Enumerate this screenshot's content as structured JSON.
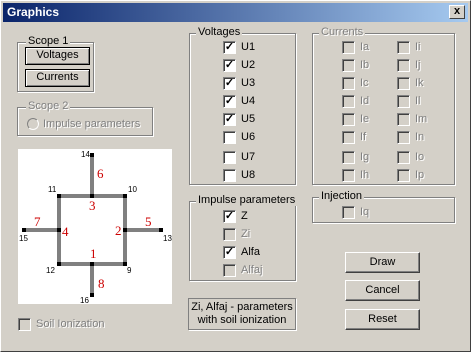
{
  "window": {
    "title": "Graphics",
    "close_glyph": "x"
  },
  "scope1": {
    "legend": "Scope 1",
    "voltages_button": "Voltages",
    "currents_button": "Currents"
  },
  "scope2": {
    "legend": "Scope 2",
    "radio_label": "Impulse parameters"
  },
  "soil": {
    "label": "Soil Ionization",
    "checked": false
  },
  "voltages": {
    "legend": "Voltages",
    "items": [
      {
        "label": "U1",
        "checked": true
      },
      {
        "label": "U2",
        "checked": true
      },
      {
        "label": "U3",
        "checked": true
      },
      {
        "label": "U4",
        "checked": true
      },
      {
        "label": "U5",
        "checked": true
      },
      {
        "label": "U6",
        "checked": false
      },
      {
        "label": "U7",
        "checked": false
      },
      {
        "label": "U8",
        "checked": false
      }
    ]
  },
  "impulse": {
    "legend": "Impulse parameters",
    "items": [
      {
        "label": "Z",
        "checked": true,
        "enabled": true
      },
      {
        "label": "Zi",
        "checked": false,
        "enabled": false
      },
      {
        "label": "Alfa",
        "checked": true,
        "enabled": true
      },
      {
        "label": "Alfaj",
        "checked": false,
        "enabled": false
      }
    ]
  },
  "note": {
    "line1": "Zi, Alfaj - parameters",
    "line2": "with soil ionization"
  },
  "currents": {
    "legend": "Currents",
    "col1": [
      "Ia",
      "Ib",
      "Ic",
      "Id",
      "Ie",
      "If",
      "Ig",
      "Ih"
    ],
    "col2": [
      "Ii",
      "Ij",
      "Ik",
      "Il",
      "Im",
      "In",
      "Io",
      "Ip"
    ]
  },
  "injection": {
    "legend": "Injection",
    "label": "Iq"
  },
  "actions": {
    "draw": "Draw",
    "cancel": "Cancel",
    "reset": "Reset"
  },
  "diagram": {
    "branch_labels": [
      "1",
      "2",
      "3",
      "4",
      "5",
      "6",
      "7",
      "8"
    ],
    "node_labels": [
      "9",
      "10",
      "11",
      "12",
      "13",
      "14",
      "15",
      "16"
    ],
    "branch_color": "#cc0000",
    "conductor_color": "#808080"
  }
}
